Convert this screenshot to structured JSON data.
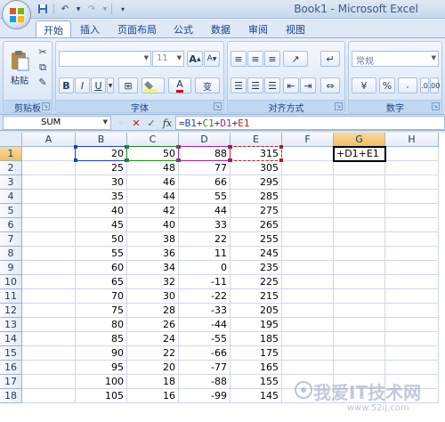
{
  "window": {
    "title": "Book1 - Microsoft Excel",
    "qat_items": [
      "save-icon",
      "undo-icon",
      "redo-icon",
      "customize-qat-icon"
    ]
  },
  "tabs": [
    "开始",
    "插入",
    "页面布局",
    "公式",
    "数据",
    "审阅",
    "视图"
  ],
  "active_tab": 0,
  "ribbon": {
    "clipboard": {
      "label": "剪贴板",
      "paste": "粘贴"
    },
    "font": {
      "label": "字体",
      "font_size": "11",
      "bold": "B",
      "italic": "I",
      "underline": "U",
      "grow": "A",
      "shrink": "A",
      "font_color": "A",
      "phonetic": "变"
    },
    "alignment": {
      "label": "对齐方式"
    },
    "number": {
      "label": "数字",
      "format": "常规",
      "percent": "%"
    }
  },
  "formula_bar": {
    "name_box": "SUM",
    "cancel": "✕",
    "enter": "✓",
    "fx": "fx",
    "parts": [
      "=",
      "B1",
      "+",
      "C1",
      "+",
      "D1",
      "+",
      "E1"
    ]
  },
  "sheet": {
    "columns": [
      "A",
      "B",
      "C",
      "D",
      "E",
      "F",
      "G",
      "H"
    ],
    "selected_column": "G",
    "selected_row": 1,
    "rows": [
      {
        "n": "1",
        "B": "20",
        "C": "50",
        "D": "88",
        "E": "315",
        "G": "+D1+E1"
      },
      {
        "n": "2",
        "B": "25",
        "C": "48",
        "D": "77",
        "E": "305"
      },
      {
        "n": "3",
        "B": "30",
        "C": "46",
        "D": "66",
        "E": "295"
      },
      {
        "n": "4",
        "B": "35",
        "C": "44",
        "D": "55",
        "E": "285"
      },
      {
        "n": "5",
        "B": "40",
        "C": "42",
        "D": "44",
        "E": "275"
      },
      {
        "n": "6",
        "B": "45",
        "C": "40",
        "D": "33",
        "E": "265"
      },
      {
        "n": "7",
        "B": "50",
        "C": "38",
        "D": "22",
        "E": "255"
      },
      {
        "n": "8",
        "B": "55",
        "C": "36",
        "D": "11",
        "E": "245"
      },
      {
        "n": "9",
        "B": "60",
        "C": "34",
        "D": "0",
        "E": "235"
      },
      {
        "n": "10",
        "B": "65",
        "C": "32",
        "D": "-11",
        "E": "225"
      },
      {
        "n": "11",
        "B": "70",
        "C": "30",
        "D": "-22",
        "E": "215"
      },
      {
        "n": "12",
        "B": "75",
        "C": "28",
        "D": "-33",
        "E": "205"
      },
      {
        "n": "13",
        "B": "80",
        "C": "26",
        "D": "-44",
        "E": "195"
      },
      {
        "n": "14",
        "B": "85",
        "C": "24",
        "D": "-55",
        "E": "185"
      },
      {
        "n": "15",
        "B": "90",
        "C": "22",
        "D": "-66",
        "E": "175"
      },
      {
        "n": "16",
        "B": "95",
        "C": "20",
        "D": "-77",
        "E": "165"
      },
      {
        "n": "17",
        "B": "100",
        "C": "18",
        "D": "-88",
        "E": "155"
      },
      {
        "n": "18",
        "B": "105",
        "C": "16",
        "D": "-99",
        "E": "145"
      }
    ]
  },
  "colors": {
    "ref_b": "#1f3fd1",
    "ref_c": "#1f8a1f",
    "ref_d": "#a41fa4",
    "ref_e": "#b41e1e"
  },
  "watermark": {
    "main": "我爱IT技术网",
    "sub": "www.52ij.com"
  }
}
